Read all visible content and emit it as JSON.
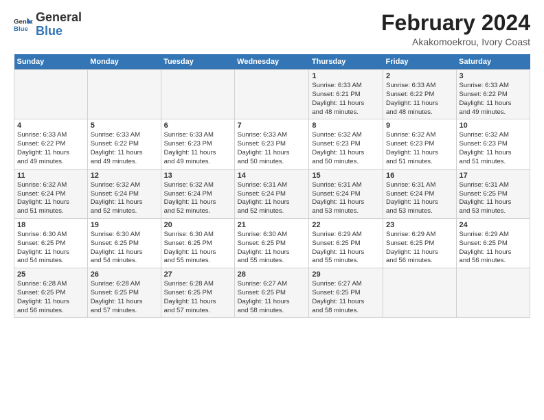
{
  "header": {
    "logo_line1": "General",
    "logo_line2": "Blue",
    "title": "February 2024",
    "subtitle": "Akakomoekrou, Ivory Coast"
  },
  "days_of_week": [
    "Sunday",
    "Monday",
    "Tuesday",
    "Wednesday",
    "Thursday",
    "Friday",
    "Saturday"
  ],
  "weeks": [
    [
      {
        "num": "",
        "info": ""
      },
      {
        "num": "",
        "info": ""
      },
      {
        "num": "",
        "info": ""
      },
      {
        "num": "",
        "info": ""
      },
      {
        "num": "1",
        "info": "Sunrise: 6:33 AM\nSunset: 6:21 PM\nDaylight: 11 hours\nand 48 minutes."
      },
      {
        "num": "2",
        "info": "Sunrise: 6:33 AM\nSunset: 6:22 PM\nDaylight: 11 hours\nand 48 minutes."
      },
      {
        "num": "3",
        "info": "Sunrise: 6:33 AM\nSunset: 6:22 PM\nDaylight: 11 hours\nand 49 minutes."
      }
    ],
    [
      {
        "num": "4",
        "info": "Sunrise: 6:33 AM\nSunset: 6:22 PM\nDaylight: 11 hours\nand 49 minutes."
      },
      {
        "num": "5",
        "info": "Sunrise: 6:33 AM\nSunset: 6:22 PM\nDaylight: 11 hours\nand 49 minutes."
      },
      {
        "num": "6",
        "info": "Sunrise: 6:33 AM\nSunset: 6:23 PM\nDaylight: 11 hours\nand 49 minutes."
      },
      {
        "num": "7",
        "info": "Sunrise: 6:33 AM\nSunset: 6:23 PM\nDaylight: 11 hours\nand 50 minutes."
      },
      {
        "num": "8",
        "info": "Sunrise: 6:32 AM\nSunset: 6:23 PM\nDaylight: 11 hours\nand 50 minutes."
      },
      {
        "num": "9",
        "info": "Sunrise: 6:32 AM\nSunset: 6:23 PM\nDaylight: 11 hours\nand 51 minutes."
      },
      {
        "num": "10",
        "info": "Sunrise: 6:32 AM\nSunset: 6:23 PM\nDaylight: 11 hours\nand 51 minutes."
      }
    ],
    [
      {
        "num": "11",
        "info": "Sunrise: 6:32 AM\nSunset: 6:24 PM\nDaylight: 11 hours\nand 51 minutes."
      },
      {
        "num": "12",
        "info": "Sunrise: 6:32 AM\nSunset: 6:24 PM\nDaylight: 11 hours\nand 52 minutes."
      },
      {
        "num": "13",
        "info": "Sunrise: 6:32 AM\nSunset: 6:24 PM\nDaylight: 11 hours\nand 52 minutes."
      },
      {
        "num": "14",
        "info": "Sunrise: 6:31 AM\nSunset: 6:24 PM\nDaylight: 11 hours\nand 52 minutes."
      },
      {
        "num": "15",
        "info": "Sunrise: 6:31 AM\nSunset: 6:24 PM\nDaylight: 11 hours\nand 53 minutes."
      },
      {
        "num": "16",
        "info": "Sunrise: 6:31 AM\nSunset: 6:24 PM\nDaylight: 11 hours\nand 53 minutes."
      },
      {
        "num": "17",
        "info": "Sunrise: 6:31 AM\nSunset: 6:25 PM\nDaylight: 11 hours\nand 53 minutes."
      }
    ],
    [
      {
        "num": "18",
        "info": "Sunrise: 6:30 AM\nSunset: 6:25 PM\nDaylight: 11 hours\nand 54 minutes."
      },
      {
        "num": "19",
        "info": "Sunrise: 6:30 AM\nSunset: 6:25 PM\nDaylight: 11 hours\nand 54 minutes."
      },
      {
        "num": "20",
        "info": "Sunrise: 6:30 AM\nSunset: 6:25 PM\nDaylight: 11 hours\nand 55 minutes."
      },
      {
        "num": "21",
        "info": "Sunrise: 6:30 AM\nSunset: 6:25 PM\nDaylight: 11 hours\nand 55 minutes."
      },
      {
        "num": "22",
        "info": "Sunrise: 6:29 AM\nSunset: 6:25 PM\nDaylight: 11 hours\nand 55 minutes."
      },
      {
        "num": "23",
        "info": "Sunrise: 6:29 AM\nSunset: 6:25 PM\nDaylight: 11 hours\nand 56 minutes."
      },
      {
        "num": "24",
        "info": "Sunrise: 6:29 AM\nSunset: 6:25 PM\nDaylight: 11 hours\nand 56 minutes."
      }
    ],
    [
      {
        "num": "25",
        "info": "Sunrise: 6:28 AM\nSunset: 6:25 PM\nDaylight: 11 hours\nand 56 minutes."
      },
      {
        "num": "26",
        "info": "Sunrise: 6:28 AM\nSunset: 6:25 PM\nDaylight: 11 hours\nand 57 minutes."
      },
      {
        "num": "27",
        "info": "Sunrise: 6:28 AM\nSunset: 6:25 PM\nDaylight: 11 hours\nand 57 minutes."
      },
      {
        "num": "28",
        "info": "Sunrise: 6:27 AM\nSunset: 6:25 PM\nDaylight: 11 hours\nand 58 minutes."
      },
      {
        "num": "29",
        "info": "Sunrise: 6:27 AM\nSunset: 6:25 PM\nDaylight: 11 hours\nand 58 minutes."
      },
      {
        "num": "",
        "info": ""
      },
      {
        "num": "",
        "info": ""
      }
    ]
  ]
}
